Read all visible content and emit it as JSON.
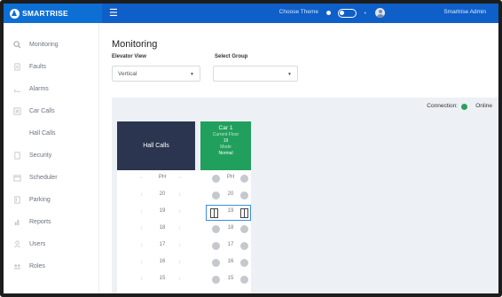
{
  "header": {
    "brand_name": "SMARTRISE",
    "menu_icon": "hamburger-icon",
    "theme_label": "Choose Theme",
    "user_name": "Smartrise Admin",
    "brand_color": "#0d6fd4"
  },
  "sidebar": {
    "items": [
      {
        "label": "Monitoring",
        "icon": "search-icon"
      },
      {
        "label": "Faults",
        "icon": "fault-icon"
      },
      {
        "label": "Alarms",
        "icon": "alarm-icon"
      },
      {
        "label": "Car Calls",
        "icon": "car-call-icon"
      },
      {
        "label": "Hall Calls",
        "icon": ""
      },
      {
        "label": "Security",
        "icon": "security-icon"
      },
      {
        "label": "Scheduler",
        "icon": "scheduler-icon"
      },
      {
        "label": "Parking",
        "icon": "parking-icon"
      },
      {
        "label": "Reports",
        "icon": "reports-icon"
      },
      {
        "label": "Users",
        "icon": "users-icon"
      },
      {
        "label": "Roles",
        "icon": "roles-icon"
      }
    ]
  },
  "main": {
    "title": "Monitoring",
    "elevator_view": {
      "label": "Elevator View",
      "value": "Vertical"
    },
    "select_group": {
      "label": "Select Group",
      "value": ""
    },
    "connection_label": "Connection:",
    "connection_status": "Online",
    "hall_calls_title": "Hall Calls",
    "car": {
      "title": "Car 1",
      "floor_label": "Current Floor",
      "floor_value": "19",
      "mode_label": "Mode",
      "mode_value": "Normal"
    },
    "floors": [
      {
        "hall": "PH",
        "car": "PH",
        "current": false
      },
      {
        "hall": "20",
        "car": "20",
        "current": false
      },
      {
        "hall": "19",
        "car": "19",
        "current": true
      },
      {
        "hall": "18",
        "car": "18",
        "current": false
      },
      {
        "hall": "17",
        "car": "17",
        "current": false
      },
      {
        "hall": "16",
        "car": "16",
        "current": false
      },
      {
        "hall": "15",
        "car": "15",
        "current": false
      }
    ],
    "colors": {
      "hall_card": "#2c3550",
      "car_card": "#21a05d",
      "online": "#2aa15c",
      "current_floor_border": "#3c8de0"
    }
  }
}
